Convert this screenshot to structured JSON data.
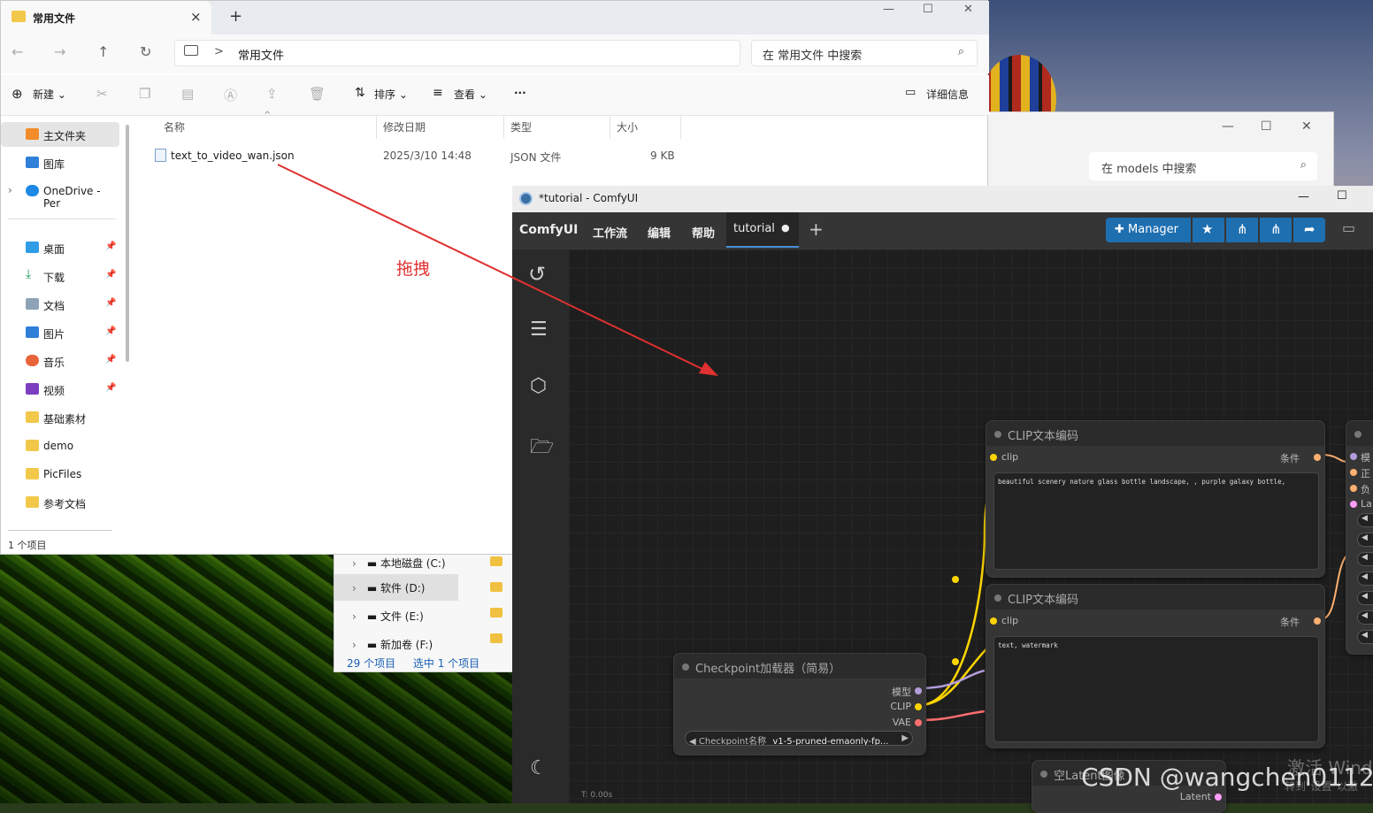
{
  "explorer": {
    "tab_title": "常用文件",
    "tab_close": "×",
    "new_tab": "+",
    "window_controls": [
      "—",
      "☐",
      "✕"
    ],
    "breadcrumb_current": "常用文件",
    "breadcrumb_sep": ">",
    "search_placeholder": "在 常用文件 中搜索",
    "toolbar": {
      "new": "新建",
      "sort": "排序",
      "view": "查看",
      "more": "···",
      "details": "详细信息"
    },
    "sidebar": [
      {
        "label": "主文件夹",
        "pinned": false,
        "selected": true
      },
      {
        "label": "图库",
        "pinned": false
      },
      {
        "label": "OneDrive - Per",
        "pinned": false
      },
      {
        "label": "桌面",
        "pinned": true
      },
      {
        "label": "下载",
        "pinned": true
      },
      {
        "label": "文档",
        "pinned": true
      },
      {
        "label": "图片",
        "pinned": true
      },
      {
        "label": "音乐",
        "pinned": true
      },
      {
        "label": "视频",
        "pinned": true
      },
      {
        "label": "基础素材",
        "pinned": false
      },
      {
        "label": "demo",
        "pinned": false
      },
      {
        "label": "PicFiles",
        "pinned": false
      },
      {
        "label": "参考文档",
        "pinned": false
      }
    ],
    "columns": [
      "名称",
      "修改日期",
      "类型",
      "大小"
    ],
    "files": [
      {
        "name": "text_to_video_wan.json",
        "date": "2025/3/10 14:48",
        "type": "JSON 文件",
        "size": "9 KB"
      }
    ],
    "status": "1 个项目",
    "annotation": "拖拽"
  },
  "models_window": {
    "search_placeholder": "在 models 中搜索"
  },
  "drives_window": {
    "drives": [
      "本地磁盘 (C:)",
      "软件 (D:)",
      "文件 (E:)",
      "新加卷 (F:)"
    ],
    "status_count": "29 个项目",
    "status_selected": "选中 1 个项目"
  },
  "comfy": {
    "window_title": "*tutorial - ComfyUI",
    "brand": "ComfyUI",
    "menu": [
      "工作流",
      "编辑",
      "帮助"
    ],
    "active_tab": "tutorial",
    "manager_label": "Manager",
    "timer": "T: 0.00s",
    "nodes": {
      "clip_pos": {
        "title": "CLIP文本编码",
        "in": "clip",
        "out": "条件",
        "text": "beautiful scenery nature glass bottle landscape, , purple galaxy bottle,"
      },
      "clip_neg": {
        "title": "CLIP文本编码",
        "in": "clip",
        "out": "条件",
        "text": "text, watermark"
      },
      "ckpt": {
        "title": "Checkpoint加载器（简易）",
        "outs": [
          "模型",
          "CLIP",
          "VAE"
        ],
        "widget_label": "Checkpoint名称",
        "widget_value": "v1-5-pruned-emaonly-fp..."
      },
      "latent": {
        "title": "空Latent图像",
        "out": "Latent"
      },
      "sampler": {
        "ins": [
          "模",
          "正",
          "负",
          "La"
        ]
      }
    }
  },
  "watermark": {
    "text": "CSDN @wangchen0112",
    "activate": "激活 Wind",
    "settings": "转到\"设置\"以激"
  },
  "colors": {
    "clip": "#ffd500",
    "model": "#b39ddb",
    "vae": "#ff6e6e",
    "latent": "#ff9cf9",
    "accent": "#1e6fb0",
    "annotation": "#e03030"
  }
}
